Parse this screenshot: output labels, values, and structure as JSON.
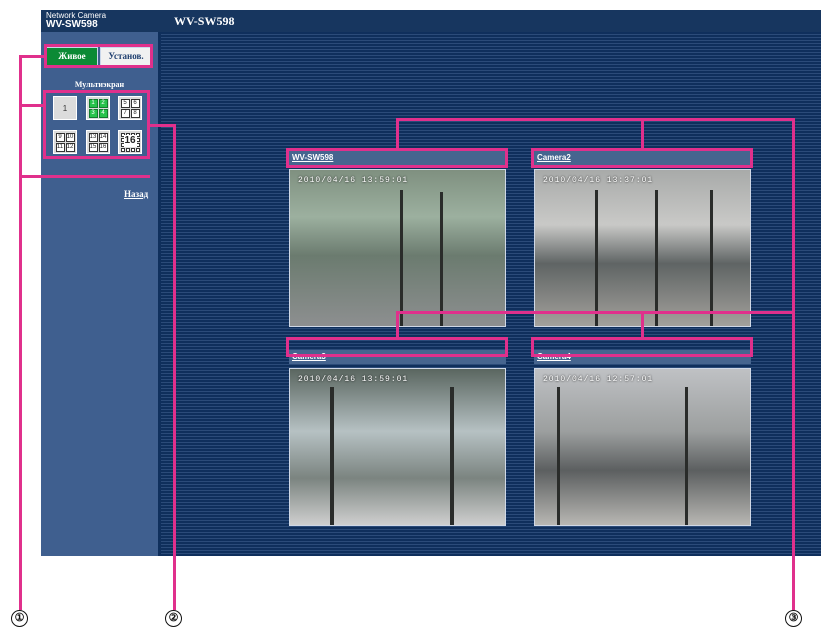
{
  "header": {
    "brand_small": "Network Camera",
    "brand_model": "WV-SW598",
    "page_title": "WV-SW598"
  },
  "sidebar": {
    "tab_live": "Живое",
    "tab_setup": "Установ.",
    "multiscreen_label": "Мультиэкран",
    "single_label": "1",
    "quad_a": [
      "1",
      "2",
      "3",
      "4"
    ],
    "quad_b": [
      "5",
      "6",
      "7",
      "8"
    ],
    "quad_c": [
      "9",
      "10",
      "11",
      "12"
    ],
    "quad_d": [
      "13",
      "14",
      "15",
      "16"
    ],
    "sixteen_label": "16",
    "back_link": "Назад"
  },
  "cameras": [
    {
      "title": "WV-SW598",
      "timestamp": "2010/04/16 13:59:01"
    },
    {
      "title": "Camera2",
      "timestamp": "2010/04/16 13:37:01"
    },
    {
      "title": "Camera3",
      "timestamp": "2010/04/16 13:59:01"
    },
    {
      "title": "Camera4",
      "timestamp": "2010/04/16 12:57:01"
    }
  ],
  "markers": [
    "①",
    "②",
    "③"
  ],
  "colors": {
    "callout": "#e0308c",
    "active_green": "#0c8a35",
    "panel_blue": "#0f2f5c"
  }
}
